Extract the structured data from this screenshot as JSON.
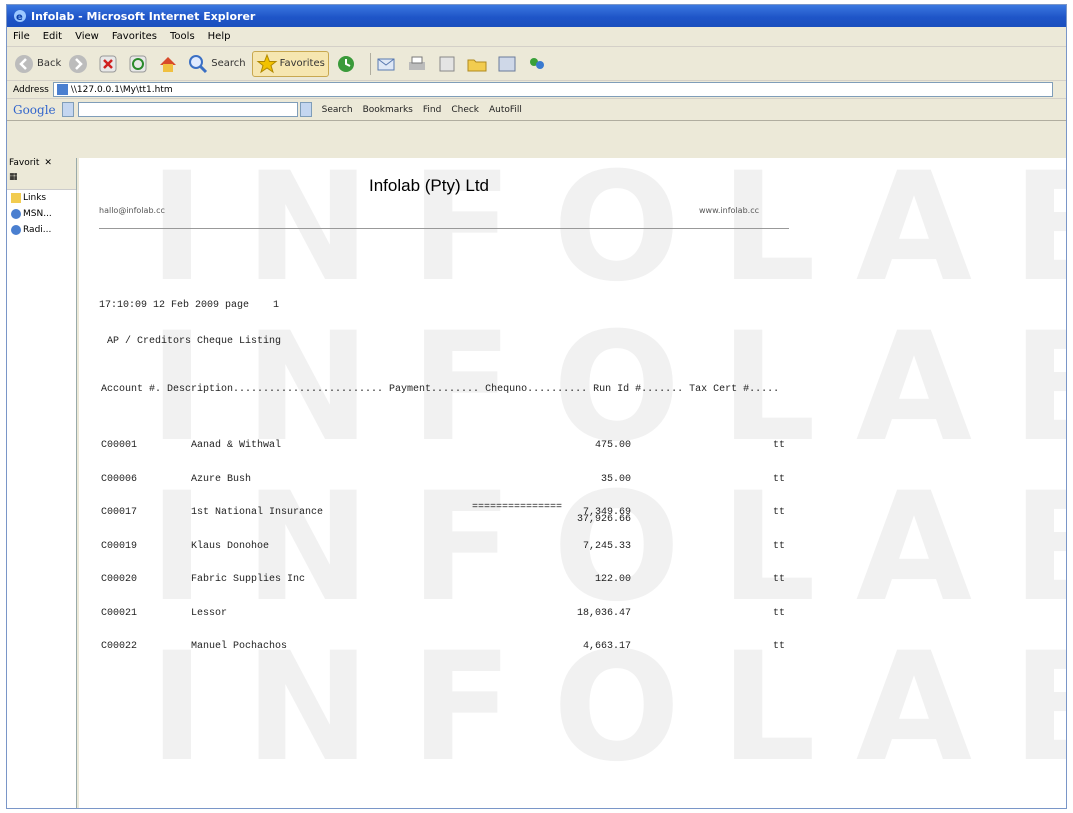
{
  "window": {
    "title": "Infolab - Microsoft Internet Explorer"
  },
  "menu": [
    "File",
    "Edit",
    "View",
    "Favorites",
    "Tools",
    "Help"
  ],
  "toolbar": {
    "back_label": "Back",
    "search_label": "Search",
    "favorites_label": "Favorites"
  },
  "address": {
    "label": "Address",
    "value": "\\\\127.0.0.1\\My\\tt1.htm"
  },
  "google": {
    "logo": "Google",
    "search_label": "Search",
    "bookmarks_label": "Bookmarks",
    "find_label": "Find",
    "check_label": "Check",
    "autofill_label": "AutoFill"
  },
  "favorites_pane": {
    "title": "Favorit",
    "items": [
      "Links",
      "MSN...",
      "Radi..."
    ]
  },
  "report": {
    "company": "Infolab (Pty) Ltd",
    "email": "hallo@infolab.cc",
    "website": "www.infolab.cc",
    "watermark": "INFOLAB",
    "timestamp": "17:10:09 12 Feb 2009 page    1",
    "title": "AP / Creditors Cheque Listing",
    "column_header": "Account #. Description......................... Payment........ Chequno.......... Run Id #....... Tax Cert #.....",
    "rows": [
      {
        "account": "C00001",
        "description": "Aanad & Withwal",
        "payment": "475.00",
        "run_id": "tt"
      },
      {
        "account": "C00006",
        "description": "Azure Bush",
        "payment": "35.00",
        "run_id": "tt"
      },
      {
        "account": "C00017",
        "description": "1st National Insurance",
        "payment": "7,349.69",
        "run_id": "tt"
      },
      {
        "account": "C00019",
        "description": "Klaus Donohoe",
        "payment": "7,245.33",
        "run_id": "tt"
      },
      {
        "account": "C00020",
        "description": "Fabric Supplies Inc",
        "payment": "122.00",
        "run_id": "tt"
      },
      {
        "account": "C00021",
        "description": "Lessor",
        "payment": "18,036.47",
        "run_id": "tt"
      },
      {
        "account": "C00022",
        "description": "Manuel Pochachos",
        "payment": "4,663.17",
        "run_id": "tt"
      }
    ],
    "total_underline": "===============",
    "total": "37,926.66"
  }
}
